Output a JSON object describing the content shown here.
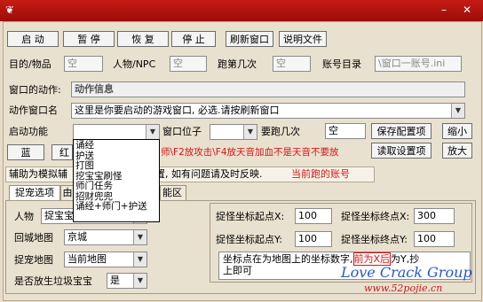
{
  "window": {
    "minimize": "–",
    "close": "✕"
  },
  "toolbar": {
    "start": "启 动",
    "pause": "暂 停",
    "resume": "恢 复",
    "stop": "停 止",
    "refresh": "刷新窗口",
    "help": "说明文件"
  },
  "info": {
    "target_label": "目的/物品",
    "target_value": "空",
    "npc_label": "人物/NPC",
    "npc_value": "空",
    "run_label": "跑第几次",
    "run_value": "空",
    "account_label": "账号目录",
    "account_value": "\\窗口一账号.ini"
  },
  "window_action": {
    "label": "窗口的动作:",
    "value": "动作信息"
  },
  "action_window": {
    "label": "动作窗口名",
    "value": "这里是你要启动的游戏窗口, 必选.请按刷新窗口"
  },
  "function_row": {
    "label": "启动功能",
    "window_pos_label": "窗口位子",
    "times_label": "要跑几次",
    "times_value": "空",
    "save_config": "保存配置项",
    "minimize_btn": "缩小",
    "read_config": "读取设置项",
    "maximize_btn": "放大"
  },
  "buttons": {
    "blue": "蓝",
    "red": "红"
  },
  "marquee": {
    "prefix": "辅助为模拟辅",
    "middle": "设置, 如有问题请及时反映.",
    "red_text": "师\\F2放攻击\\F4放天音加血不是天音不要放",
    "account_text": "当前跑的账号"
  },
  "dropdown": {
    "options": [
      "诵经",
      "护送",
      "打图",
      "挖宝宝刷怪",
      "师门任务",
      "招财兜兜",
      "诵经+师门+护送"
    ]
  },
  "tabs": [
    {
      "label": "捉宠选项"
    },
    {
      "label": "由"
    },
    {
      "label": "能区"
    }
  ],
  "left_panel": {
    "person_label": "人物",
    "person_value": "捉宝宝",
    "return_label": "回城地图",
    "return_value": "京城",
    "catch_label": "捉宠地图",
    "catch_value": "当前地图",
    "discard_label": "是否放生垃圾宝宝",
    "discard_value": "是"
  },
  "right_panel": {
    "start_x_label": "捉怪坐标起点X:",
    "start_x": "100",
    "end_x_label": "捉怪坐标终点X:",
    "end_x": "300",
    "start_y_label": "捉怪坐标起点Y:",
    "start_y": "100",
    "end_y_label": "捉怪坐标终点Y:",
    "end_y": "100",
    "note_prefix": "坐标点在为地图上的坐标数字,",
    "note_red": "前为X后",
    "note_suffix": "为Y,抄",
    "note_line2": "上即可"
  },
  "watermark": {
    "group": "Love Crack Group",
    "url": "www.52pojie.cn"
  }
}
